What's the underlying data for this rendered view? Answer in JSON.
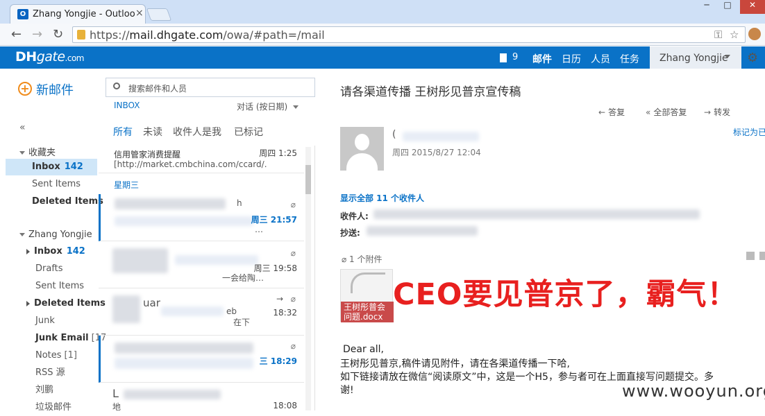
{
  "browser": {
    "tab_title": "Zhang Yongjie - Outloo",
    "tab_close": "×",
    "url_scheme": "https://",
    "url_host": "mail.dhgate.com",
    "url_path": "/owa/#path=/mail",
    "window_controls": [
      "─",
      "□",
      "✕"
    ]
  },
  "header": {
    "logo_dh": "DH",
    "logo_rest": "gate",
    "logo_com": ".com",
    "notification_count": "9",
    "nav": [
      "邮件",
      "日历",
      "人员",
      "任务"
    ],
    "user_name": "Zhang Yongjie"
  },
  "sidebar": {
    "new_mail_label": "新邮件",
    "collapse": "«",
    "favorites_title": "收藏夹",
    "favorites": [
      {
        "label": "Inbox",
        "count": "142"
      },
      {
        "label": "Sent Items"
      },
      {
        "label": "Deleted Items"
      }
    ],
    "account_title": "Zhang Yongjie",
    "folders": [
      {
        "label": "Inbox",
        "count": "142"
      },
      {
        "label": "Drafts"
      },
      {
        "label": "Sent Items"
      },
      {
        "label": "Deleted Items"
      },
      {
        "label": "Junk"
      },
      {
        "label": "Junk Email",
        "count": "[17"
      },
      {
        "label": "Notes",
        "count": "[1]"
      },
      {
        "label": "RSS 源"
      },
      {
        "label": "刘鹏"
      },
      {
        "label": "垃圾邮件"
      }
    ]
  },
  "message_list": {
    "search_placeholder": "搜索邮件和人员",
    "folder_label": "INBOX",
    "sort_label": "对话 (按日期)",
    "filters": [
      "所有",
      "未读",
      "收件人是我",
      "已标记"
    ],
    "messages": [
      {
        "from": "信用管家消费提醒",
        "preview": "[http://market.cmbchina.com/ccard/…",
        "time": "周四 1:25"
      },
      {
        "day_header": "星期三"
      },
      {
        "from": "h",
        "preview": "…",
        "time": "周三 21:57"
      },
      {
        "from": "",
        "preview": "一会给陶…",
        "time": "周三 19:58"
      },
      {
        "from": "uar",
        "preview": "eb",
        "time": "18:32",
        "preview_extra": "在下"
      },
      {
        "from": "",
        "preview": "",
        "time": "三 18:29"
      },
      {
        "from": "L",
        "preview": "地",
        "time": "18:08"
      }
    ]
  },
  "reading_pane": {
    "subject": "请各渠道传播 王树彤见普京宣传稿",
    "actions": [
      "答复",
      "全部答复",
      "转发"
    ],
    "action_icons": [
      "←",
      "«",
      "→"
    ],
    "sender_name": "(",
    "sent_date": "周四 2015/8/27 12:04",
    "mark_read": "标记为已",
    "show_all_recipients": "显示全部 11 个收件人",
    "to_label": "收件人:",
    "cc_label": "抄送:",
    "attachment_count": "1 个附件",
    "attachment_name": "王树彤普会问题.docx",
    "overlay": "CEO要见普京了，霸气！",
    "body_lines": [
      "Dear all,",
      "王树彤见普京,稿件请见附件，请在各渠道传播一下哈,",
      "如下链接请放在微信“阅读原文”中，这是一个H5，参与者可在上面直接写问题提交。多",
      "谢!"
    ]
  },
  "watermark": "www.wooyun.org"
}
